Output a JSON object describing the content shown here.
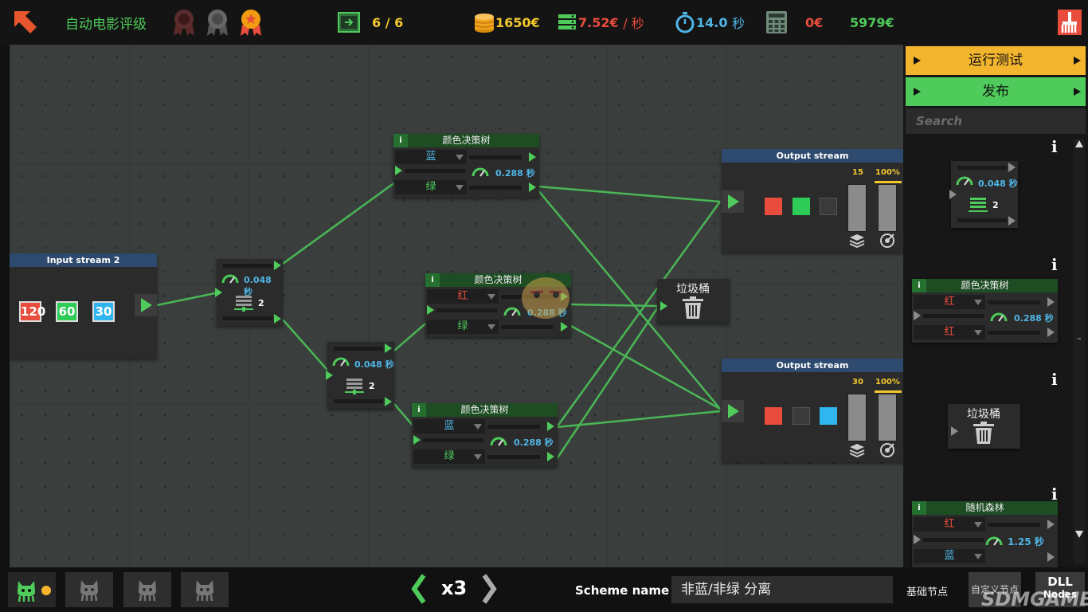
{
  "topbar": {
    "level_title": "自动电影评级",
    "tasks": "6 / 6",
    "coins": "1650",
    "throughput_value": "7.52",
    "throughput_unit": "/ 秒",
    "time_value": "14.0",
    "time_unit": "秒",
    "cost_value": "0",
    "total_value": "5979",
    "currency": "€"
  },
  "input_stream": {
    "title": "Input stream 2",
    "items": [
      "120",
      "60",
      "30"
    ]
  },
  "splitter1": {
    "speed": "0.048 秒",
    "count": "2"
  },
  "splitter2": {
    "speed": "0.048 秒",
    "count": "2"
  },
  "dt_top": {
    "title": "颜色决策树",
    "info": "i",
    "row1": "蓝",
    "row2": "绿",
    "speed": "0.288 秒"
  },
  "dt_mid": {
    "title": "颜色决策树",
    "info": "i",
    "row1": "红",
    "row2": "绿",
    "speed": "0.288 秒"
  },
  "dt_bot": {
    "title": "颜色决策树",
    "info": "i",
    "row1": "蓝",
    "row2": "绿",
    "speed": "0.288 秒"
  },
  "trash": {
    "label": "垃圾桶"
  },
  "output1": {
    "title": "Output stream",
    "count": "15",
    "percent": "100%",
    "colors": [
      "#e74c3c",
      "#2ecc57",
      "#3a3a3a"
    ]
  },
  "output2": {
    "title": "Output stream",
    "count": "30",
    "percent": "100%",
    "colors": [
      "#e74c3c",
      "#3a3a3a",
      "#31b5f0"
    ]
  },
  "panel": {
    "run_test": "运行测试",
    "publish": "发布",
    "search_placeholder": "Search",
    "info": "i",
    "splitter": {
      "speed": "0.048 秒",
      "count": "2"
    },
    "dt": {
      "title": "颜色决策树",
      "row1": "红",
      "row2": "红",
      "speed": "0.288 秒"
    },
    "trash": "垃圾桶",
    "rf": {
      "title": "随机森林",
      "row1": "红",
      "row2": "蓝",
      "speed": "1.25 秒"
    },
    "tab_basic": "基础节点",
    "tab_custom": "自定义节点",
    "tab_dll": "DLL",
    "tab_dll_sub": "Nodes"
  },
  "bottom": {
    "multiplier": "x3",
    "scheme_label": "Scheme name :",
    "scheme_value": "非蓝/非绿 分离"
  },
  "watermark": "SDMGAME"
}
